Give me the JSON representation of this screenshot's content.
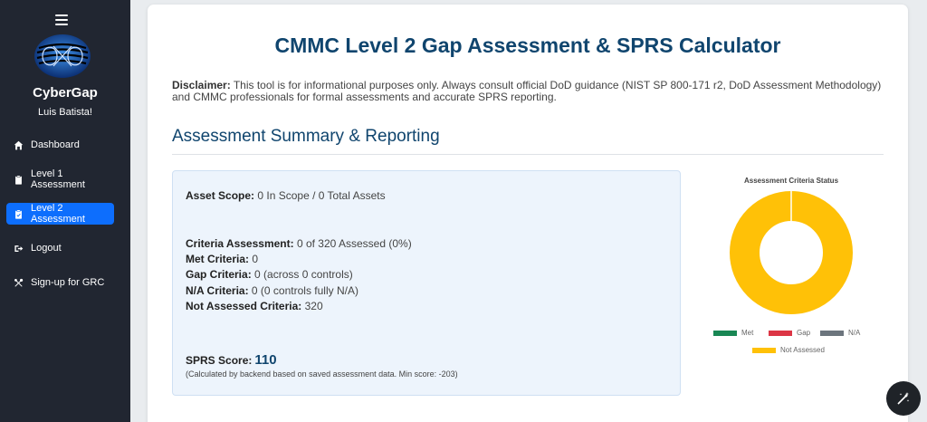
{
  "sidebar": {
    "brand": "CyberGap",
    "user_name": "Luis Batista!",
    "items": [
      {
        "label": "Dashboard",
        "icon": "home-icon"
      },
      {
        "label": "Level 1 Assessment",
        "icon": "clipboard-icon"
      },
      {
        "label": "Level 2 Assessment",
        "icon": "clipboard-check-icon",
        "active": true
      },
      {
        "label": "Logout",
        "icon": "sign-out-icon"
      },
      {
        "label": "Sign-up for GRC",
        "icon": "tools-icon"
      }
    ]
  },
  "main": {
    "title": "CMMC Level 2 Gap Assessment & SPRS Calculator",
    "disclaimer_label": "Disclaimer:",
    "disclaimer_text": "This tool is for informational purposes only. Always consult official DoD guidance (NIST SP 800-171 r2, DoD Assessment Methodology) and CMMC professionals for formal assessments and accurate SPRS reporting.",
    "section_heading": "Assessment Summary & Reporting"
  },
  "summary": {
    "asset_scope_label": "Asset Scope:",
    "asset_scope_value": "0 In Scope / 0 Total Assets",
    "criteria_assessment_label": "Criteria Assessment:",
    "criteria_assessment_value": "0 of 320 Assessed (0%)",
    "met_label": "Met Criteria:",
    "met_value": "0",
    "gap_label": "Gap Criteria:",
    "gap_value": "0 (across 0 controls)",
    "na_label": "N/A Criteria:",
    "na_value": "0 (0 controls fully N/A)",
    "not_assessed_label": "Not Assessed Criteria:",
    "not_assessed_value": "320",
    "sprs_label": "SPRS Score:",
    "sprs_value": "110",
    "sprs_note": "(Calculated by backend based on saved assessment data. Min score: -203)"
  },
  "chart_data": {
    "type": "pie",
    "title": "Assessment Criteria Status",
    "categories": [
      "Met",
      "Gap",
      "N/A",
      "Not Assessed"
    ],
    "values": [
      0,
      0,
      0,
      320
    ],
    "colors": [
      "#198754",
      "#dc3545",
      "#6c757d",
      "#ffc107"
    ],
    "legend_position": "bottom",
    "donut": true
  },
  "colors": {
    "sidebar_bg": "#212631",
    "active_nav": "#0d6efd",
    "heading": "#10456e",
    "summary_bg": "#edf4fc"
  },
  "fab": {
    "icon": "magic-wand-icon"
  }
}
